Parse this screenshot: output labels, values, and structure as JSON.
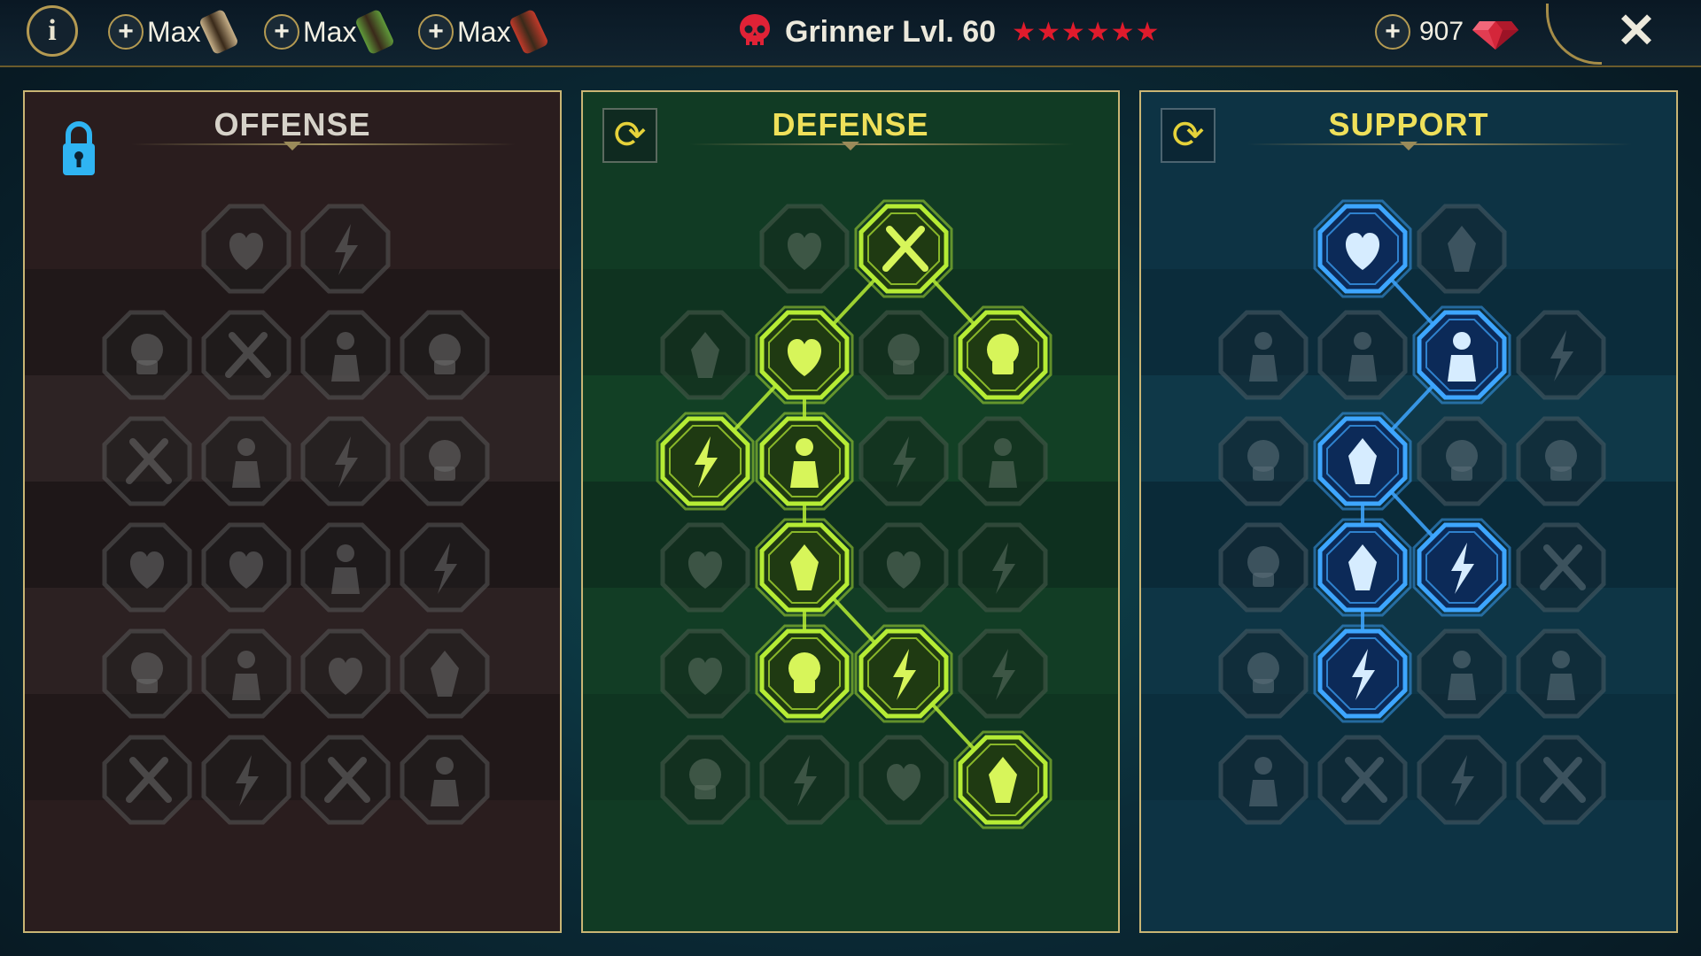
{
  "topbar": {
    "info_label": "i",
    "books": [
      {
        "plus": "+",
        "label": "Max",
        "color": "#c9b28a"
      },
      {
        "plus": "+",
        "label": "Max",
        "color": "#5f9a3a"
      },
      {
        "plus": "+",
        "label": "Max",
        "color": "#c23a2a"
      }
    ],
    "champion_name": "Grinner Lvl. 60",
    "stars": "★★★★★★",
    "gems_plus": "+",
    "gems_count": "907",
    "close_label": "✕"
  },
  "trees": [
    {
      "id": "offense",
      "title": "OFFENSE",
      "locked": true,
      "accent": "#8a8280",
      "rows": [
        [
          "",
          "cross-swords",
          "dagger-slash",
          ""
        ],
        [
          "horned-heart",
          "sword-swipe",
          "shield-break",
          "bleeding-heart"
        ],
        [
          "arrows-hit",
          "jaws",
          "skull-cloak",
          "claw-hand"
        ],
        [
          "heart-blade",
          "punch-fist",
          "axe-chop",
          "chain-lightning"
        ],
        [
          "spider-cave",
          "twin-skulls",
          "sword-aura",
          "rage-warrior"
        ],
        [
          "star-sword",
          "knight-helm",
          "horned-demon",
          "spartan-skull"
        ]
      ],
      "active": []
    },
    {
      "id": "defense",
      "title": "DEFENSE",
      "reset": "⟳",
      "accent": "#b6ec35",
      "rows": [
        [
          "",
          "shield-tiles",
          "fist",
          ""
        ],
        [
          "hood-shield",
          "heart-vial",
          "muscle-torso",
          "crossed-blades"
        ],
        [
          "runner-aura",
          "knight-shield",
          "heart",
          "hooded-aura"
        ],
        [
          "crowd",
          "hourglass-skull",
          "open-palm",
          "bull-head"
        ],
        [
          "dash-figure",
          "triple-drops",
          "skull-sun",
          "grab-hand"
        ],
        [
          "hero-bust",
          "winged-shield",
          "reaper",
          "flex-warrior"
        ]
      ],
      "active": [
        "0-2",
        "1-1",
        "1-3",
        "2-0",
        "2-1",
        "3-1",
        "4-1",
        "4-2",
        "5-3"
      ],
      "links": [
        [
          "0-2",
          "1-1"
        ],
        [
          "0-2",
          "1-3"
        ],
        [
          "1-1",
          "2-0"
        ],
        [
          "1-1",
          "2-1"
        ],
        [
          "2-1",
          "3-1"
        ],
        [
          "3-1",
          "4-1"
        ],
        [
          "3-1",
          "4-2"
        ],
        [
          "4-2",
          "5-3"
        ]
      ]
    },
    {
      "id": "support",
      "title": "SUPPORT",
      "reset": "⟳",
      "accent": "#3ea6ff",
      "rows": [
        [
          "",
          "heart-plus",
          "swirl-ring",
          ""
        ],
        [
          "praying-hands",
          "hood-arc",
          "skull-flame",
          "speed-strike"
        ],
        [
          "healer",
          "lightning-bolt",
          "fissure",
          "shadow-figure"
        ],
        [
          "chained-heart",
          "comet",
          "open-book",
          "angry-eyes"
        ],
        [
          "compass-star",
          "swift-boot",
          "eye",
          "crossed-bones"
        ],
        [
          "potion-skull",
          "horned-skull",
          "fist-crest",
          "eagle"
        ]
      ],
      "active": [
        "0-1",
        "1-2",
        "2-1",
        "3-1",
        "3-2",
        "4-1"
      ],
      "links": [
        [
          "0-1",
          "1-2"
        ],
        [
          "1-2",
          "2-1"
        ],
        [
          "2-1",
          "3-1"
        ],
        [
          "2-1",
          "3-2"
        ],
        [
          "3-1",
          "4-1"
        ]
      ]
    }
  ]
}
